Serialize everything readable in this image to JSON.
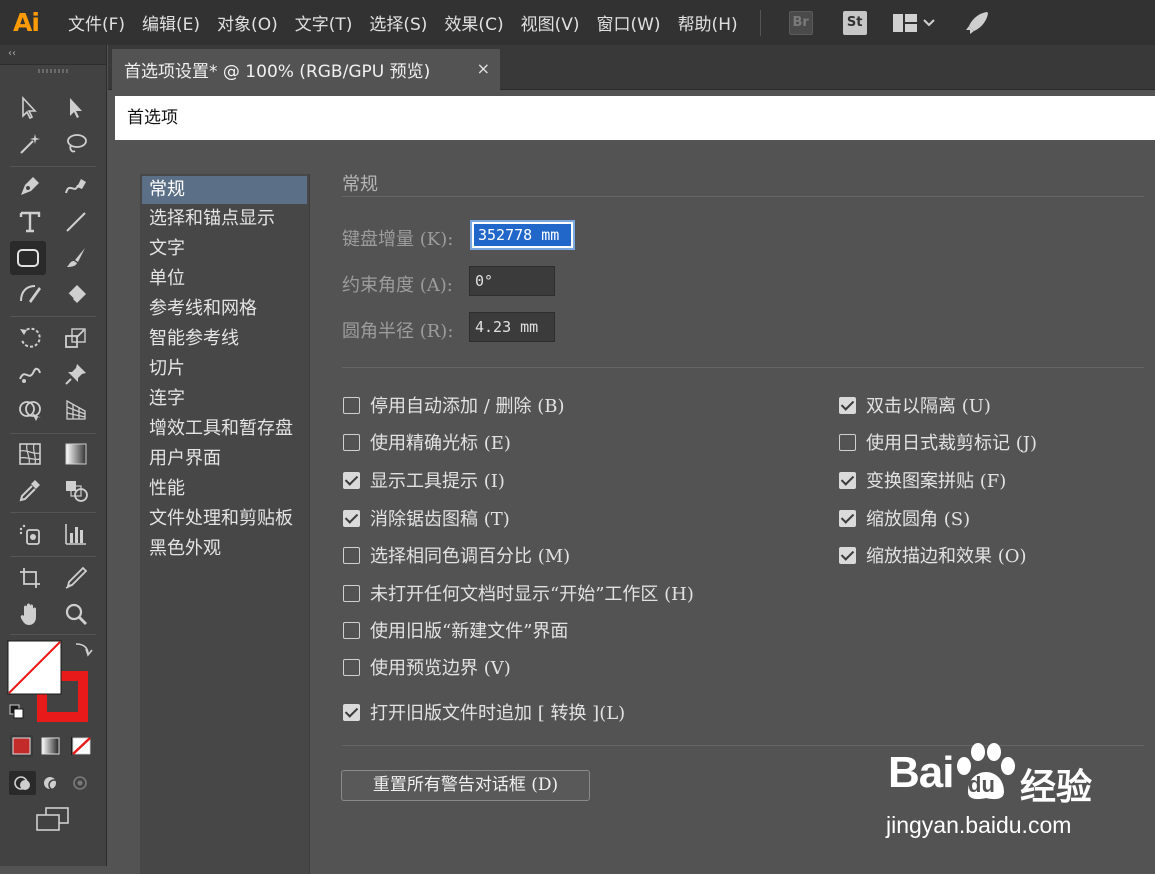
{
  "app": {
    "logo": "Ai"
  },
  "menu": [
    "文件(F)",
    "编辑(E)",
    "对象(O)",
    "文字(T)",
    "选择(S)",
    "效果(C)",
    "视图(V)",
    "窗口(W)",
    "帮助(H)"
  ],
  "app_buttons": {
    "bridge": "Br",
    "stock": "St"
  },
  "toolbar": {
    "collapse": "‹‹"
  },
  "document_tab": {
    "title": "首选项设置* @ 100% (RGB/GPU 预览)",
    "close": "×"
  },
  "dialog": {
    "title": "首选项",
    "nav": [
      "常规",
      "选择和锚点显示",
      "文字",
      "单位",
      "参考线和网格",
      "智能参考线",
      "切片",
      "连字",
      "增效工具和暂存盘",
      "用户界面",
      "性能",
      "文件处理和剪贴板",
      "黑色外观"
    ],
    "selected_nav": "常规",
    "pane_title": "常规",
    "fields": {
      "keyboard_increment": {
        "label": "键盘增量 (K):",
        "value": "352778 mm"
      },
      "constrain_angle": {
        "label": "约束角度 (A):",
        "value": "0°"
      },
      "corner_radius": {
        "label": "圆角半径 (R):",
        "value": "4.23 mm"
      }
    },
    "checkboxes_left": [
      {
        "label": "停用自动添加 / 删除 (B)",
        "checked": false
      },
      {
        "label": "使用精确光标 (E)",
        "checked": false
      },
      {
        "label": "显示工具提示 (I)",
        "checked": true
      },
      {
        "label": "消除锯齿图稿 (T)",
        "checked": true
      },
      {
        "label": "选择相同色调百分比 (M)",
        "checked": false
      },
      {
        "label": "未打开任何文档时显示“开始”工作区 (H)",
        "checked": false
      },
      {
        "label": "使用旧版“新建文件”界面",
        "checked": false
      },
      {
        "label": "使用预览边界 (V)",
        "checked": false
      },
      {
        "label": "打开旧版文件时追加 [ 转换 ](L)",
        "checked": true
      }
    ],
    "checkboxes_right": [
      {
        "label": "双击以隔离 (U)",
        "checked": true
      },
      {
        "label": "使用日式裁剪标记 (J)",
        "checked": false
      },
      {
        "label": "变换图案拼贴 (F)",
        "checked": true
      },
      {
        "label": "缩放圆角 (S)",
        "checked": true
      },
      {
        "label": "缩放描边和效果 (O)",
        "checked": true
      }
    ],
    "reset_button": "重置所有警告对话框 (D)"
  },
  "watermark": {
    "brand": "Bai",
    "brand_du": "du",
    "cn": "经验",
    "url": "jingyan.baidu.com"
  },
  "colors": {
    "accent_selected": "#5b6f86",
    "stroke_red": "#e81a1a",
    "ai_orange": "#ff9a00"
  }
}
